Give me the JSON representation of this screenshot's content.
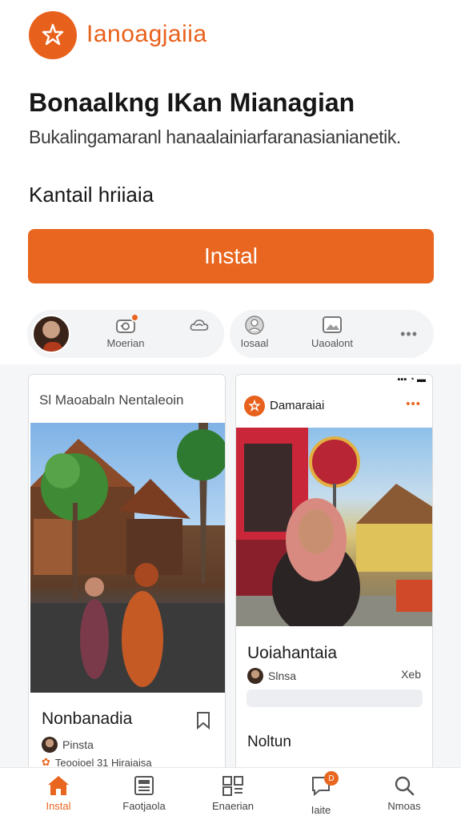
{
  "app": {
    "name": "Ianoagjaiia"
  },
  "hero": {
    "title": "Bonaalkng IKan Mianagian",
    "subtitle": "Bukalingamaranl hanaalainiarfaranasianianetik.",
    "section_label": "Kantail hriiaia",
    "install_label": "Instal"
  },
  "quick_actions": {
    "left": [
      {
        "label": "Moerian",
        "icon": "camera-icon"
      },
      {
        "label": "",
        "icon": "cloud-icon"
      }
    ],
    "right": [
      {
        "label": "Iosaal",
        "icon": "profile-icon"
      },
      {
        "label": "Uaoalont",
        "icon": "image-icon"
      },
      {
        "label": "",
        "icon": "more-icon"
      }
    ]
  },
  "cards": [
    {
      "header_title": "Sl Maoabaln Nentaleoin",
      "name": "Nonbanadia",
      "author": "Pinsta",
      "meta": "Teooioel 31 Hiraiaisa"
    },
    {
      "app_name": "Damaraiai",
      "more": "•••",
      "name": "Uoiahantaia",
      "author": "Slnsa",
      "meta_right": "Xeb",
      "name2": "Noltun"
    }
  ],
  "bottom_nav": [
    {
      "label": "Instal",
      "icon": "home-icon",
      "active": true
    },
    {
      "label": "Faotjaola",
      "icon": "newspaper-icon",
      "active": false
    },
    {
      "label": "Enaerian",
      "icon": "grid-icon",
      "active": false
    },
    {
      "label": "Iaite",
      "icon": "chat-icon",
      "active": false,
      "badge": "D"
    },
    {
      "label": "Nmoas",
      "icon": "search-icon",
      "active": false
    }
  ],
  "colors": {
    "accent": "#e8661f",
    "text": "#1b1b1b",
    "muted": "#f3f4f6"
  }
}
